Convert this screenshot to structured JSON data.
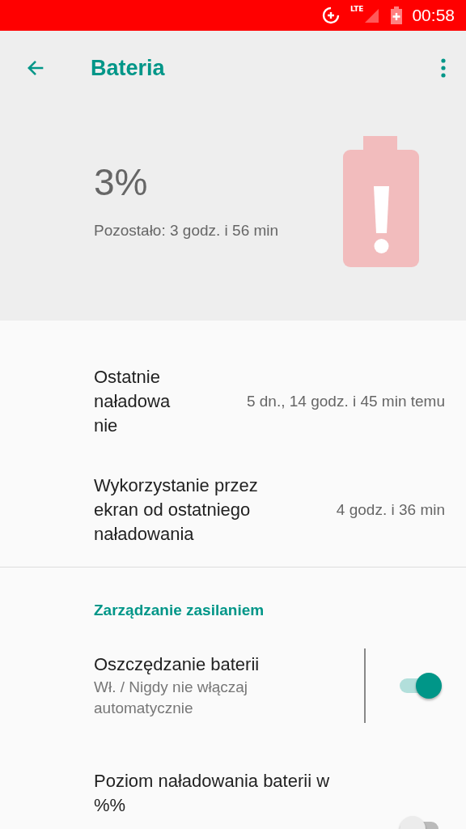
{
  "status_bar": {
    "time": "00:58",
    "network": "LTE"
  },
  "app_bar": {
    "title": "Bateria"
  },
  "summary": {
    "level_text": "3%",
    "remaining": "Pozostało: 3 godz. i 56 min"
  },
  "info_rows": [
    {
      "label": "Ostatnie naładowa nie",
      "value": "5 dn., 14 godz. i 45 min temu"
    },
    {
      "label": "Wykorzystanie przez ekran od ostatniego naładowania",
      "value": "4 godz. i 36 min"
    }
  ],
  "section": {
    "title": "Zarządzanie zasilaniem"
  },
  "settings": [
    {
      "title": "Oszczędzanie baterii",
      "summary": "Wł. / Nigdy nie włączaj automatycznie",
      "divider": true,
      "on": true
    },
    {
      "title": "Poziom naładowania baterii w %%",
      "divider": false,
      "on": false
    }
  ]
}
